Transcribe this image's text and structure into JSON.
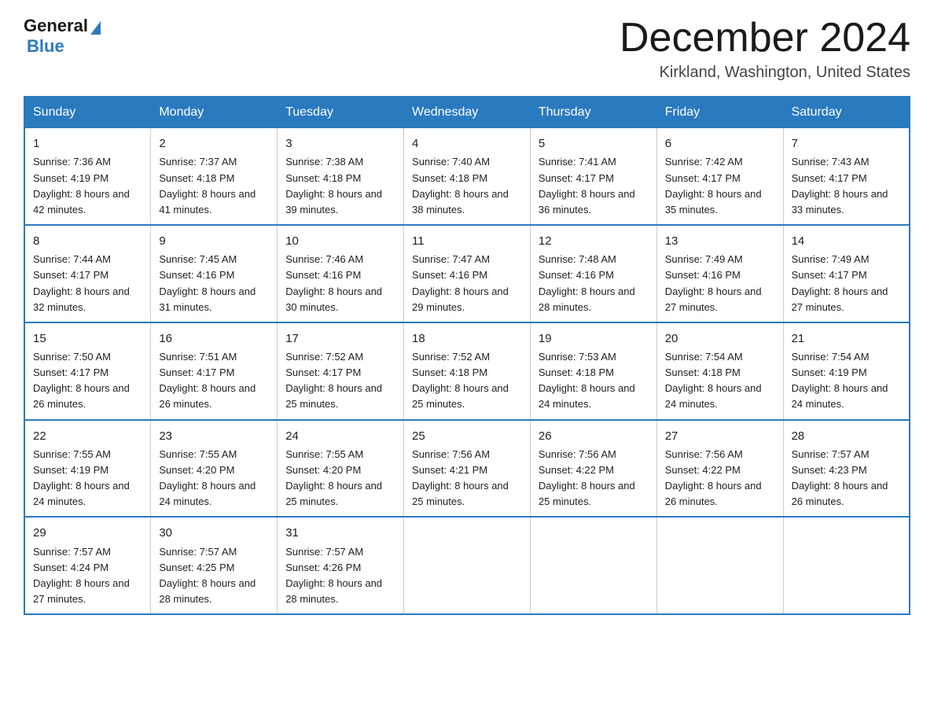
{
  "header": {
    "logo": {
      "general": "General",
      "blue": "Blue",
      "line2": "Blue"
    },
    "title": "December 2024",
    "location": "Kirkland, Washington, United States"
  },
  "calendar": {
    "days_of_week": [
      "Sunday",
      "Monday",
      "Tuesday",
      "Wednesday",
      "Thursday",
      "Friday",
      "Saturday"
    ],
    "weeks": [
      [
        {
          "day": 1,
          "sunrise": "7:36 AM",
          "sunset": "4:19 PM",
          "daylight": "8 hours and 42 minutes."
        },
        {
          "day": 2,
          "sunrise": "7:37 AM",
          "sunset": "4:18 PM",
          "daylight": "8 hours and 41 minutes."
        },
        {
          "day": 3,
          "sunrise": "7:38 AM",
          "sunset": "4:18 PM",
          "daylight": "8 hours and 39 minutes."
        },
        {
          "day": 4,
          "sunrise": "7:40 AM",
          "sunset": "4:18 PM",
          "daylight": "8 hours and 38 minutes."
        },
        {
          "day": 5,
          "sunrise": "7:41 AM",
          "sunset": "4:17 PM",
          "daylight": "8 hours and 36 minutes."
        },
        {
          "day": 6,
          "sunrise": "7:42 AM",
          "sunset": "4:17 PM",
          "daylight": "8 hours and 35 minutes."
        },
        {
          "day": 7,
          "sunrise": "7:43 AM",
          "sunset": "4:17 PM",
          "daylight": "8 hours and 33 minutes."
        }
      ],
      [
        {
          "day": 8,
          "sunrise": "7:44 AM",
          "sunset": "4:17 PM",
          "daylight": "8 hours and 32 minutes."
        },
        {
          "day": 9,
          "sunrise": "7:45 AM",
          "sunset": "4:16 PM",
          "daylight": "8 hours and 31 minutes."
        },
        {
          "day": 10,
          "sunrise": "7:46 AM",
          "sunset": "4:16 PM",
          "daylight": "8 hours and 30 minutes."
        },
        {
          "day": 11,
          "sunrise": "7:47 AM",
          "sunset": "4:16 PM",
          "daylight": "8 hours and 29 minutes."
        },
        {
          "day": 12,
          "sunrise": "7:48 AM",
          "sunset": "4:16 PM",
          "daylight": "8 hours and 28 minutes."
        },
        {
          "day": 13,
          "sunrise": "7:49 AM",
          "sunset": "4:16 PM",
          "daylight": "8 hours and 27 minutes."
        },
        {
          "day": 14,
          "sunrise": "7:49 AM",
          "sunset": "4:17 PM",
          "daylight": "8 hours and 27 minutes."
        }
      ],
      [
        {
          "day": 15,
          "sunrise": "7:50 AM",
          "sunset": "4:17 PM",
          "daylight": "8 hours and 26 minutes."
        },
        {
          "day": 16,
          "sunrise": "7:51 AM",
          "sunset": "4:17 PM",
          "daylight": "8 hours and 26 minutes."
        },
        {
          "day": 17,
          "sunrise": "7:52 AM",
          "sunset": "4:17 PM",
          "daylight": "8 hours and 25 minutes."
        },
        {
          "day": 18,
          "sunrise": "7:52 AM",
          "sunset": "4:18 PM",
          "daylight": "8 hours and 25 minutes."
        },
        {
          "day": 19,
          "sunrise": "7:53 AM",
          "sunset": "4:18 PM",
          "daylight": "8 hours and 24 minutes."
        },
        {
          "day": 20,
          "sunrise": "7:54 AM",
          "sunset": "4:18 PM",
          "daylight": "8 hours and 24 minutes."
        },
        {
          "day": 21,
          "sunrise": "7:54 AM",
          "sunset": "4:19 PM",
          "daylight": "8 hours and 24 minutes."
        }
      ],
      [
        {
          "day": 22,
          "sunrise": "7:55 AM",
          "sunset": "4:19 PM",
          "daylight": "8 hours and 24 minutes."
        },
        {
          "day": 23,
          "sunrise": "7:55 AM",
          "sunset": "4:20 PM",
          "daylight": "8 hours and 24 minutes."
        },
        {
          "day": 24,
          "sunrise": "7:55 AM",
          "sunset": "4:20 PM",
          "daylight": "8 hours and 25 minutes."
        },
        {
          "day": 25,
          "sunrise": "7:56 AM",
          "sunset": "4:21 PM",
          "daylight": "8 hours and 25 minutes."
        },
        {
          "day": 26,
          "sunrise": "7:56 AM",
          "sunset": "4:22 PM",
          "daylight": "8 hours and 25 minutes."
        },
        {
          "day": 27,
          "sunrise": "7:56 AM",
          "sunset": "4:22 PM",
          "daylight": "8 hours and 26 minutes."
        },
        {
          "day": 28,
          "sunrise": "7:57 AM",
          "sunset": "4:23 PM",
          "daylight": "8 hours and 26 minutes."
        }
      ],
      [
        {
          "day": 29,
          "sunrise": "7:57 AM",
          "sunset": "4:24 PM",
          "daylight": "8 hours and 27 minutes."
        },
        {
          "day": 30,
          "sunrise": "7:57 AM",
          "sunset": "4:25 PM",
          "daylight": "8 hours and 28 minutes."
        },
        {
          "day": 31,
          "sunrise": "7:57 AM",
          "sunset": "4:26 PM",
          "daylight": "8 hours and 28 minutes."
        },
        null,
        null,
        null,
        null
      ]
    ]
  }
}
